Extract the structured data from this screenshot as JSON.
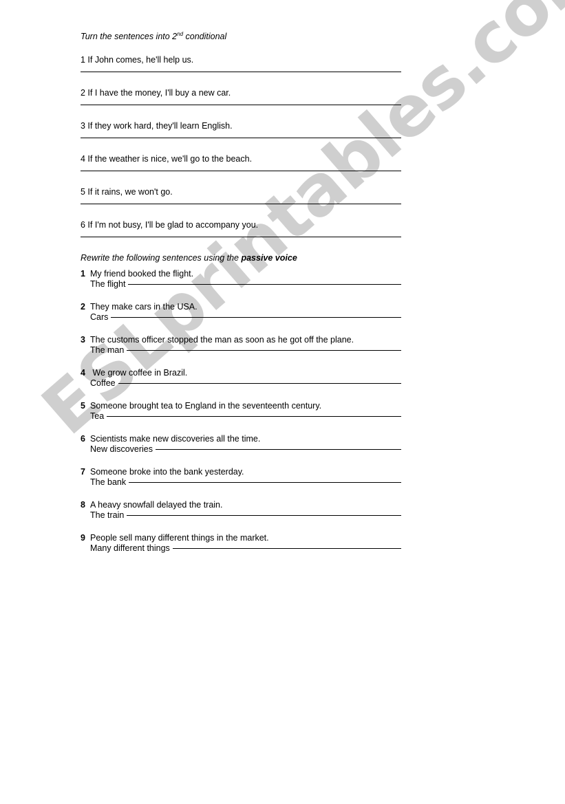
{
  "watermark": {
    "text": "ESLprintables.com",
    "color": "#cfcfcf"
  },
  "exercise_one": {
    "heading_prefix": "Turn the sentences into 2",
    "heading_sup": "nd",
    "heading_suffix": " conditional",
    "items": [
      {
        "number": "1",
        "sentence": "1 If John comes, he'll help us."
      },
      {
        "number": "2",
        "sentence": "2 If I have the money, I'll buy a new car."
      },
      {
        "number": "3",
        "sentence": "3 If they work hard, they'll learn English."
      },
      {
        "number": "4",
        "sentence": "4 If the weather is nice, we'll go to the beach."
      },
      {
        "number": "5",
        "sentence": "5 If it rains, we won't go."
      },
      {
        "number": "6",
        "sentence": "6 If I'm not busy, I'll be glad to accompany you."
      }
    ]
  },
  "exercise_two": {
    "heading_normal": "Rewrite the following sentences using the ",
    "heading_bold": "passive voice",
    "items": [
      {
        "number": "1",
        "sentence": "My friend booked the flight.",
        "stub": "The flight"
      },
      {
        "number": "2",
        "sentence": "They make cars in the USA.",
        "stub": "Cars"
      },
      {
        "number": "3",
        "sentence": "The customs officer stopped the man as soon as he got off the plane.",
        "stub": "The man"
      },
      {
        "number": "4",
        "sentence": " We grow coffee in Brazil.",
        "stub": "Coffee"
      },
      {
        "number": "5",
        "sentence": "Someone brought tea to England in the seventeenth century.",
        "stub": "Tea"
      },
      {
        "number": "6",
        "sentence": "Scientists make new discoveries all the time.",
        "stub": "New discoveries"
      },
      {
        "number": "7",
        "sentence": "Someone broke into the bank yesterday.",
        "stub": "The bank"
      },
      {
        "number": "8",
        "sentence": "A heavy snowfall delayed the train.",
        "stub": "The train"
      },
      {
        "number": "9",
        "sentence": "People sell many different things in the market.",
        "stub": "Many different things"
      }
    ]
  }
}
